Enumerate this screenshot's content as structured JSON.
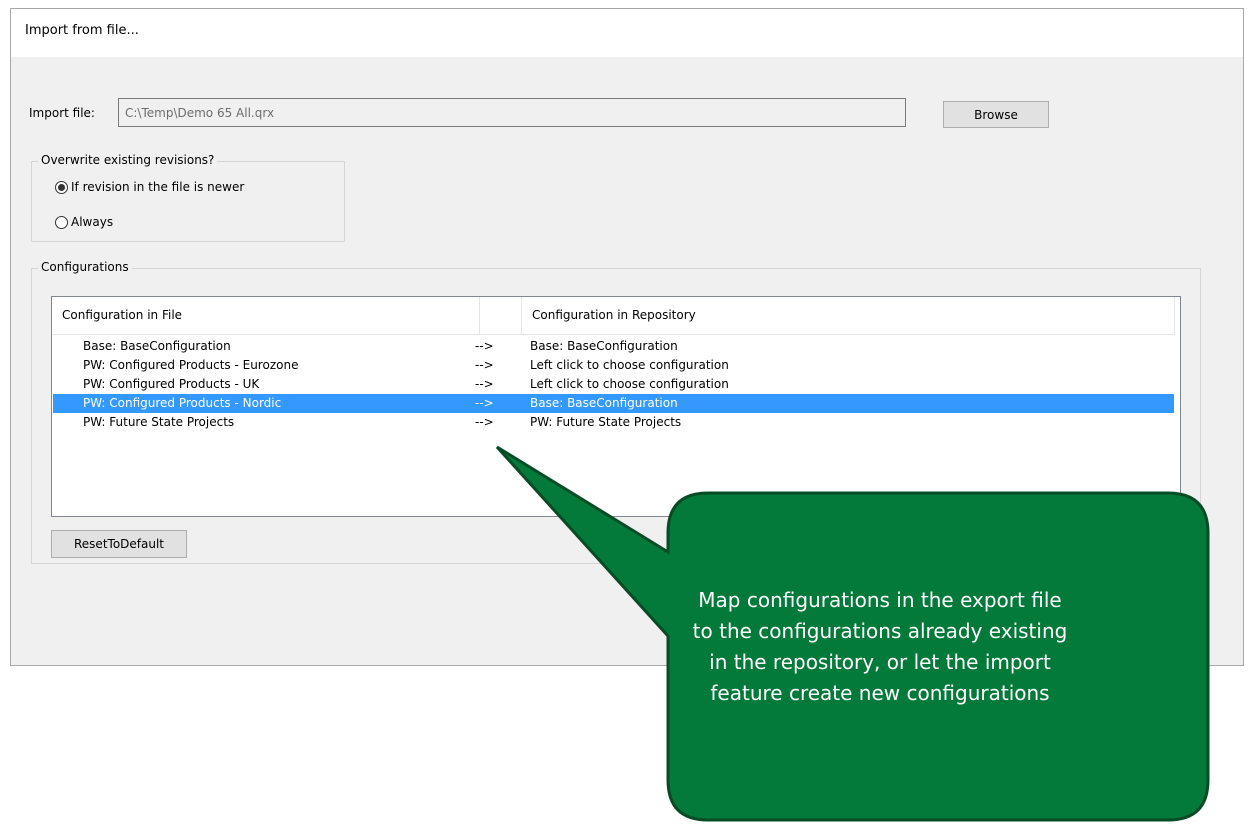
{
  "dialog": {
    "title": "Import from file..."
  },
  "import_file": {
    "label": "Import file:",
    "value": "C:\\Temp\\Demo 65 All.qrx",
    "browse_label": "Browse"
  },
  "overwrite": {
    "legend": "Overwrite existing revisions?",
    "options": [
      {
        "label": "If revision in the file is newer",
        "checked": true
      },
      {
        "label": "Always",
        "checked": false
      }
    ]
  },
  "configurations": {
    "legend": "Configurations",
    "columns": [
      "Configuration in File",
      "",
      "Configuration in Repository"
    ],
    "rows": [
      {
        "file": "Base: BaseConfiguration",
        "arrow": "-->",
        "repo": "Base: BaseConfiguration",
        "selected": false
      },
      {
        "file": "PW: Configured Products - Eurozone",
        "arrow": "-->",
        "repo": "Left click to choose configuration",
        "selected": false
      },
      {
        "file": "PW: Configured Products - UK",
        "arrow": "-->",
        "repo": "Left click to choose configuration",
        "selected": false
      },
      {
        "file": "PW: Configured Products - Nordic",
        "arrow": "-->",
        "repo": "Base: BaseConfiguration",
        "selected": true
      },
      {
        "file": "PW: Future State Projects",
        "arrow": "-->",
        "repo": "PW: Future State Projects",
        "selected": false
      }
    ],
    "reset_label": "ResetToDefault"
  },
  "callout": {
    "text": "Map configurations in the export file to the configurations already existing in the repository, or let the import feature create new configurations",
    "color": "#037a3a"
  },
  "colors": {
    "selection": "#3399ff",
    "dialog_bg": "#f0f0f0"
  }
}
